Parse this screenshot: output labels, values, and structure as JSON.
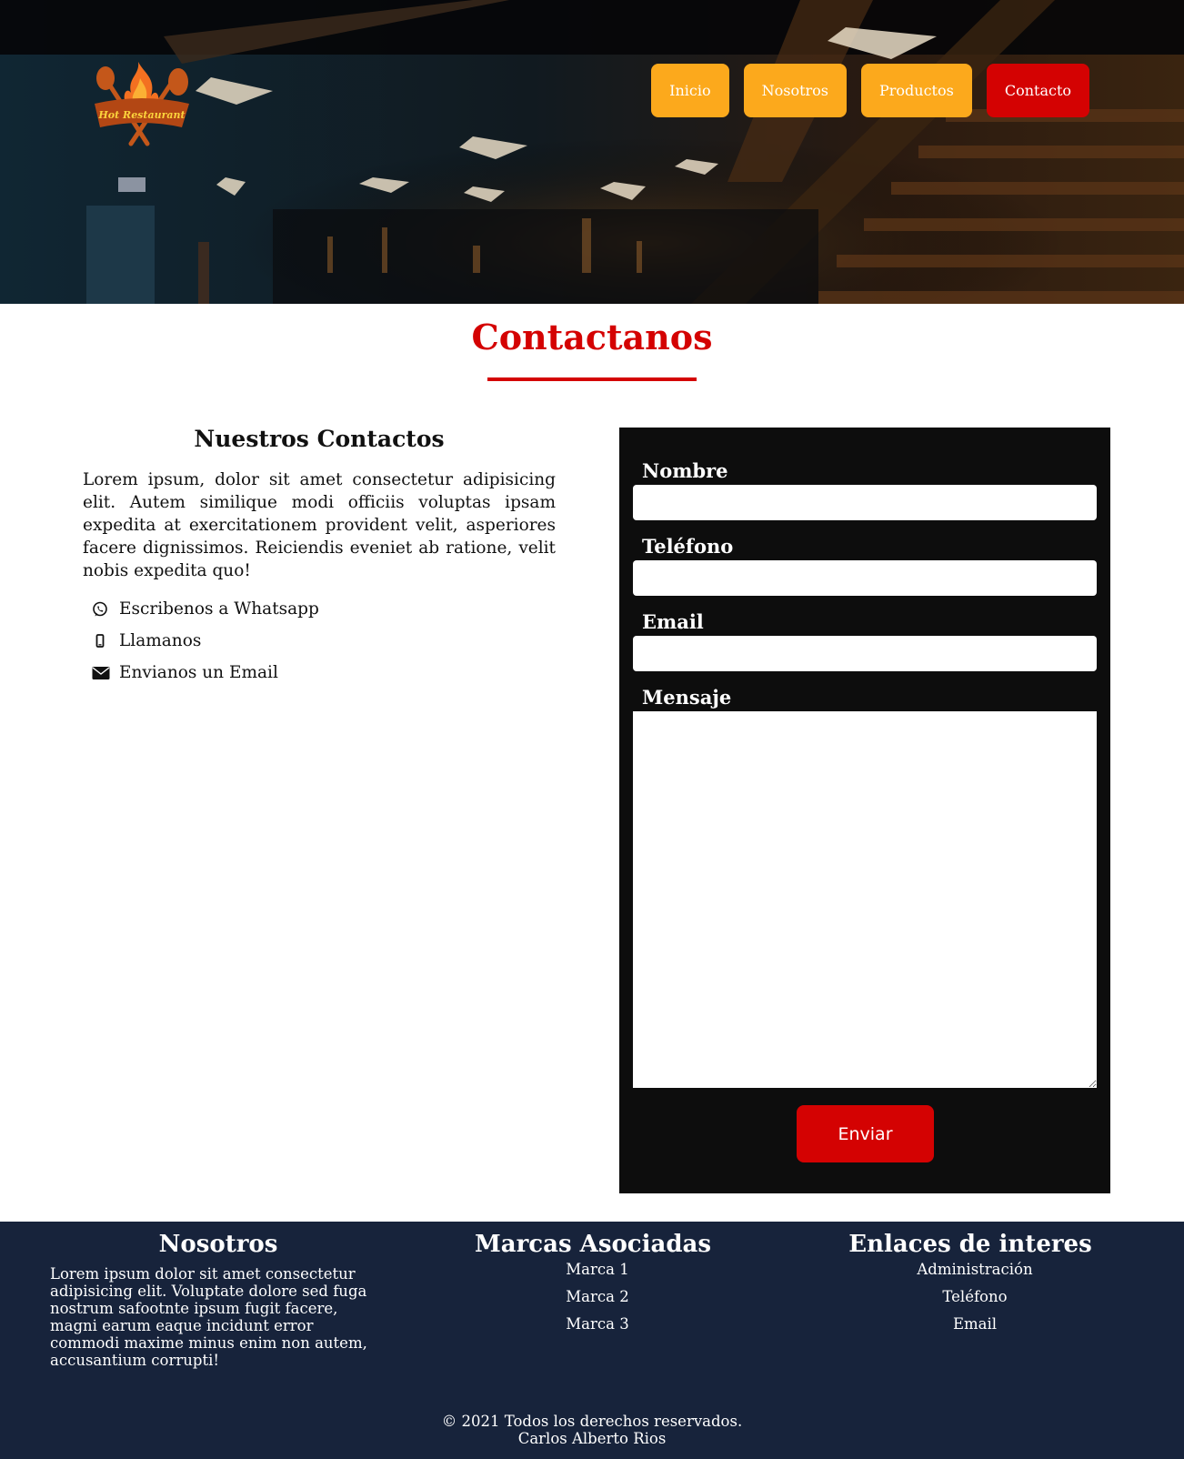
{
  "header": {
    "logo_text": "Hot Restaurant",
    "nav": [
      {
        "label": "Inicio"
      },
      {
        "label": "Nosotros"
      },
      {
        "label": "Productos"
      },
      {
        "label": "Contacto"
      }
    ]
  },
  "main": {
    "title": "Contactanos",
    "contacts": {
      "heading": "Nuestros Contactos",
      "text": "Lorem ipsum, dolor sit amet consectetur adipisicing elit. Autem similique modi officiis voluptas ipsam expedita at exercitationem provident velit, asperiores facere dignissimos. Reiciendis eveniet ab ratione, velit nobis expedita quo!",
      "items": [
        {
          "icon": "whatsapp-icon",
          "label": "Escribenos a Whatsapp"
        },
        {
          "icon": "mobile-phone-icon",
          "label": "Llamanos"
        },
        {
          "icon": "envelope-icon",
          "label": "Envianos un Email"
        }
      ]
    },
    "form": {
      "name_label": "Nombre",
      "phone_label": "Teléfono",
      "email_label": "Email",
      "message_label": "Mensaje",
      "name_value": "",
      "phone_value": "",
      "email_value": "",
      "message_value": "",
      "submit_label": "Enviar"
    }
  },
  "footer": {
    "about": {
      "heading": "Nosotros",
      "text": "Lorem ipsum dolor sit amet consectetur adipisicing elit. Voluptate dolore sed fuga nostrum safootnte ipsum fugit facere, magni earum eaque incidunt error commodi maxime minus enim non autem, accusantium corrupti!"
    },
    "brands": {
      "heading": "Marcas Asociadas",
      "items": [
        "Marca 1",
        "Marca 2",
        "Marca 3"
      ]
    },
    "links": {
      "heading": "Enlaces de interes",
      "items": [
        "Administración",
        "Teléfono",
        "Email"
      ]
    },
    "copyright_line1": "© 2021 Todos los derechos reservados.",
    "copyright_line2": "Carlos Alberto Rios"
  },
  "colors": {
    "accent_red": "#d40202",
    "nav_orange": "#fca91c",
    "form_bg": "#0d0d0d",
    "footer_bg": "#17233b"
  }
}
